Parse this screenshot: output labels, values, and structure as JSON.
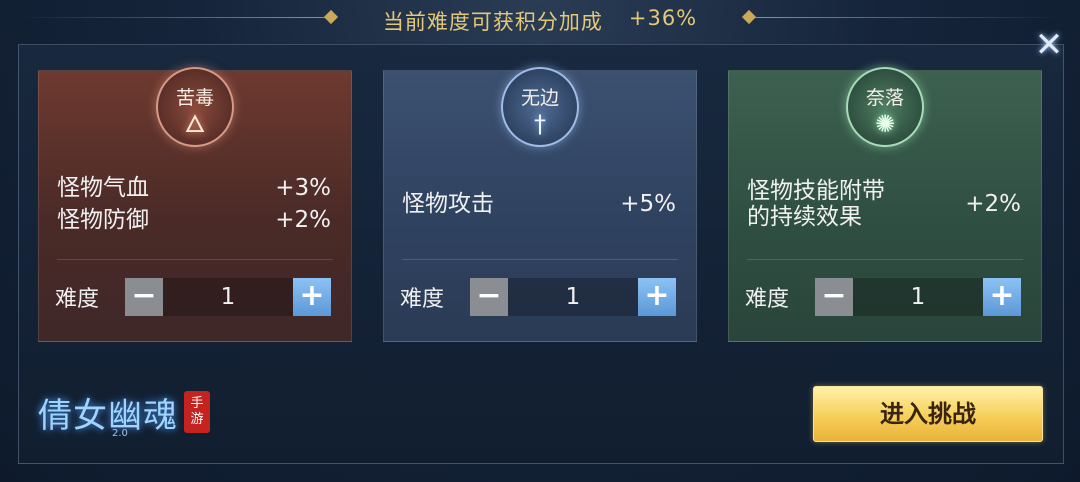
{
  "banner": {
    "label": "当前难度可获积分加成",
    "value": "+36%"
  },
  "close_icon": "close-icon",
  "cards": [
    {
      "name": "苦毒",
      "icon": "flame-icon",
      "effects": [
        {
          "label": "怪物气血",
          "value": "+3%"
        },
        {
          "label": "怪物防御",
          "value": "+2%"
        }
      ],
      "difficulty_label": "难度",
      "difficulty_value": "1"
    },
    {
      "name": "无边",
      "icon": "sword-icon",
      "effects": [
        {
          "label": "怪物攻击",
          "value": "+5%"
        }
      ],
      "difficulty_label": "难度",
      "difficulty_value": "1"
    },
    {
      "name": "奈落",
      "icon": "poison-splash-icon",
      "effects": [
        {
          "label": "怪物技能附带的持续效果",
          "label_lines": [
            "怪物技能附带",
            "的持续效果"
          ],
          "value": "+2%"
        }
      ],
      "difficulty_label": "难度",
      "difficulty_value": "1"
    }
  ],
  "logo": {
    "title": "倩女幽魂",
    "version": "2.0",
    "stamp_line1": "手",
    "stamp_line2": "游"
  },
  "enter_button": "进入挑战",
  "colors": {
    "banner_gold": "#e4c778",
    "card_red": "#6e3a30",
    "card_blue": "#3c5070",
    "card_green": "#3d6150",
    "button_gold": "#f6cf59",
    "plus_blue": "#5c98d8"
  }
}
